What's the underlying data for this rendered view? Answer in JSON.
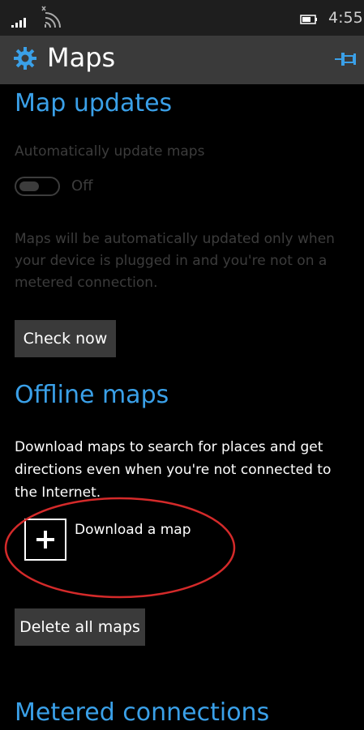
{
  "status_bar": {
    "time": "4:55",
    "signal_icon": "signal-bars-icon",
    "wifi_icon": "wifi-icon",
    "battery_icon": "battery-icon"
  },
  "header": {
    "title": "Maps",
    "settings_icon": "gear-icon",
    "pin_icon": "pin-icon"
  },
  "map_updates": {
    "section_title": "Map updates",
    "auto_update_label": "Automatically update maps",
    "toggle_state": "Off",
    "description": "Maps will be automatically updated only when your device is plugged in and you're not on a metered connection.",
    "check_now_label": "Check now"
  },
  "offline_maps": {
    "section_title": "Offline maps",
    "description": "Download maps to search for places and get directions even when you're not connected to the Internet.",
    "download_label": "Download a map",
    "delete_all_label": "Delete all maps"
  },
  "metered": {
    "section_title": "Metered connections"
  },
  "colors": {
    "accent": "#3aa0e8",
    "annotation": "#d42a2a",
    "header_bg": "#3a3a3a",
    "disabled_text": "#3c3c3c"
  }
}
